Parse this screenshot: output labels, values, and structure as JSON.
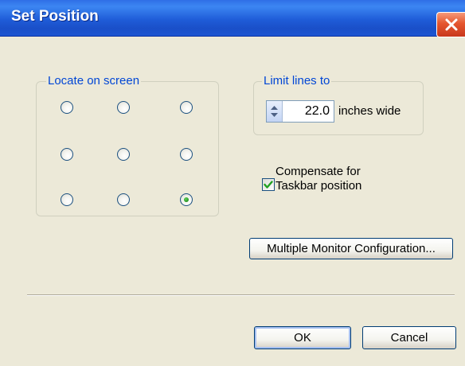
{
  "window": {
    "title": "Set Position"
  },
  "locate_group": {
    "legend": "Locate on screen",
    "selected_position": "bottom-right",
    "positions": [
      "top-left",
      "top-center",
      "top-right",
      "middle-left",
      "center",
      "middle-right",
      "bottom-left",
      "bottom-center",
      "bottom-right"
    ]
  },
  "limit_group": {
    "legend": "Limit lines to",
    "value": "22.0",
    "unit_label": "inches wide"
  },
  "compensate": {
    "label_line1": "Compensate for",
    "label_line2": "Taskbar position",
    "checked": true
  },
  "buttons": {
    "multi_monitor": "Multiple Monitor Configuration...",
    "ok": "OK",
    "cancel": "Cancel"
  },
  "colors": {
    "title_bar": "#1F5CD8",
    "group_label": "#0046D5",
    "dialog_bg": "#ECE9D8"
  }
}
